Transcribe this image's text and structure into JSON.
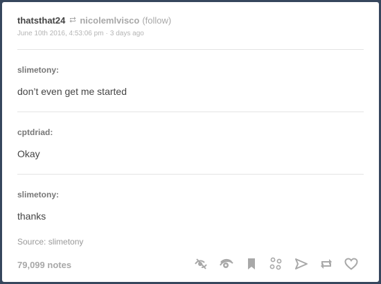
{
  "post": {
    "reblogger": "thatsthat24",
    "source_user": "nicolemlvisco",
    "follow_label": "(follow)",
    "date": "June 10th 2016, 4:53:06 pm",
    "separator": "·",
    "relative_time": "3 days ago"
  },
  "chat": [
    {
      "speaker": "slimetony:",
      "message": "don’t even get me started"
    },
    {
      "speaker": "cptdriad:",
      "message": "Okay"
    },
    {
      "speaker": "slimetony:",
      "message": "thanks"
    }
  ],
  "source_text": "Source: slimetony",
  "notes": "79,099 notes",
  "actions": [
    {
      "icon": "eye-slash-icon",
      "name": "hide-button"
    },
    {
      "icon": "eye-icon",
      "name": "view-button"
    },
    {
      "icon": "bookmark-icon",
      "name": "bookmark-button"
    },
    {
      "icon": "nodes-icon",
      "name": "notes-button"
    },
    {
      "icon": "send-icon",
      "name": "share-button"
    },
    {
      "icon": "reblog-icon",
      "name": "reblog-button"
    },
    {
      "icon": "heart-icon",
      "name": "like-button"
    }
  ],
  "colors": {
    "background": "#36465d",
    "card": "#ffffff",
    "icon_gray": "#a8a8a8"
  }
}
